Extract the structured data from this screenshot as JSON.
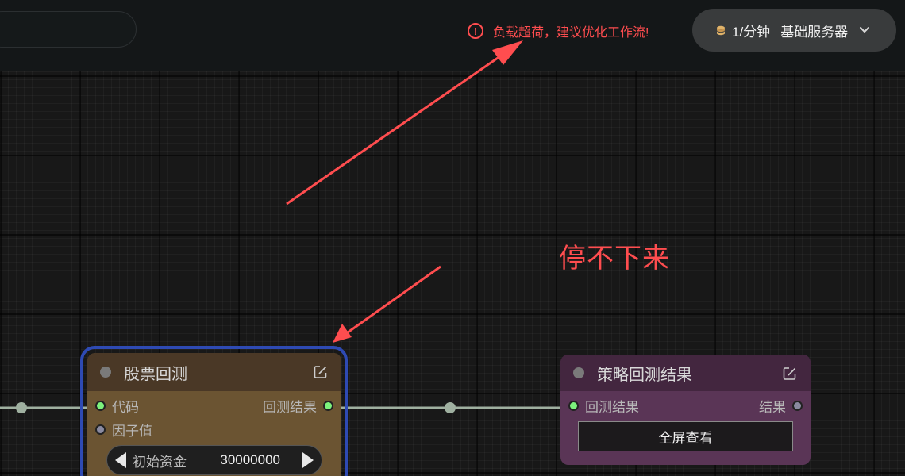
{
  "topbar": {
    "warning_text": "负载超荷，建议优化工作流!",
    "warning_icon": "exclamation-circle-icon",
    "server_select": {
      "rate": "1/分钟",
      "server_name": "基础服务器",
      "coin_icon": "coin-stack-icon",
      "chevron_icon": "chevron-down-icon"
    },
    "colors": {
      "warning": "#ff4d4f",
      "background": "#141718"
    }
  },
  "annotation": {
    "text": "停不下来",
    "color": "#ff4d4f"
  },
  "nodes": {
    "stock_backtest": {
      "title": "股票回测",
      "inputs": [
        "代码",
        "因子值"
      ],
      "outputs": [
        "回测结果"
      ],
      "widget": {
        "label": "初始资金",
        "value": "30000000"
      },
      "selected": true,
      "colors": {
        "header": "#4a3826",
        "body": "#6b5432",
        "selection": "#2e4ab3"
      }
    },
    "strategy_result": {
      "title": "策略回测结果",
      "inputs": [
        "回测结果"
      ],
      "outputs": [
        "结果"
      ],
      "button_label": "全屏查看",
      "colors": {
        "header": "#43263f",
        "body": "#5a3556"
      }
    }
  }
}
